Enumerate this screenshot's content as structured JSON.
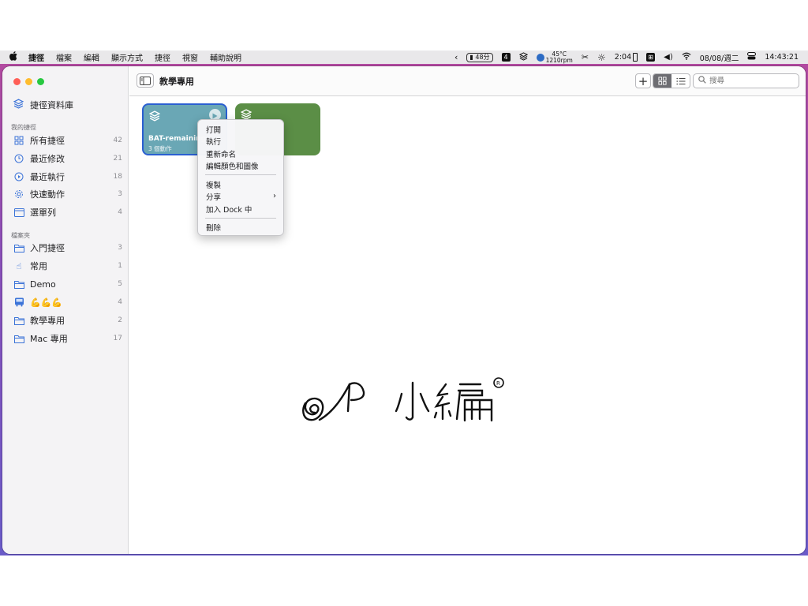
{
  "menubar": {
    "app_menus": [
      "捷徑",
      "檔案",
      "編輯",
      "顯示方式",
      "捷徑",
      "視窗",
      "輔助說明"
    ],
    "status": {
      "battery_pill": "48分",
      "badge_number": "4",
      "temp_top": "45°C",
      "temp_bottom": "1210rpm",
      "brightness_time": "2:04",
      "date": "08/08/週二",
      "clock": "14:43:21"
    },
    "icons": [
      "apple-icon",
      "chevron-left-icon",
      "shortcuts-icon",
      "fan-icon",
      "scissors-icon",
      "brightness-icon",
      "battery-icon",
      "input-method-icon",
      "volume-icon",
      "wifi-icon",
      "control-center-icon"
    ]
  },
  "sidebar": {
    "library_label": "捷徑資料庫",
    "my_shortcuts_title": "我的捷徑",
    "my_shortcuts": [
      {
        "label": "所有捷徑",
        "count": "42",
        "icon": "grid-icon"
      },
      {
        "label": "最近修改",
        "count": "21",
        "icon": "clock-icon"
      },
      {
        "label": "最近執行",
        "count": "18",
        "icon": "play-circle-icon"
      },
      {
        "label": "快速動作",
        "count": "3",
        "icon": "gear-icon"
      },
      {
        "label": "選單列",
        "count": "4",
        "icon": "menubar-icon"
      }
    ],
    "folders_title": "檔案夾",
    "folders": [
      {
        "label": "入門捷徑",
        "count": "3",
        "icon": "folder-icon"
      },
      {
        "label": "常用",
        "count": "1",
        "icon": "hand-tap-icon"
      },
      {
        "label": "Demo",
        "count": "5",
        "icon": "folder-icon"
      },
      {
        "label": "💪💪💪",
        "count": "4",
        "icon": "bus-icon"
      },
      {
        "label": "教學專用",
        "count": "2",
        "icon": "folder-icon"
      },
      {
        "label": "Mac 專用",
        "count": "17",
        "icon": "folder-icon"
      }
    ]
  },
  "toolbar": {
    "title": "教學專用",
    "search_placeholder": "搜尋"
  },
  "cards": [
    {
      "name": "BAT-remaining",
      "subtitle": "3 個動作",
      "color": "#6aa7b5"
    },
    {
      "name": "",
      "subtitle": "",
      "color": "#5b8e46"
    }
  ],
  "context_menu": {
    "items": [
      "打開",
      "執行",
      "重新命名",
      "編輯顏色和圖像",
      "複製",
      "分享",
      "加入 Dock 中",
      "刪除"
    ]
  },
  "colors": {
    "accent": "#3b73d8",
    "selection_border": "#2a5fd1",
    "wallpaper": "#b54a9e"
  },
  "watermark_text": "A 小編"
}
